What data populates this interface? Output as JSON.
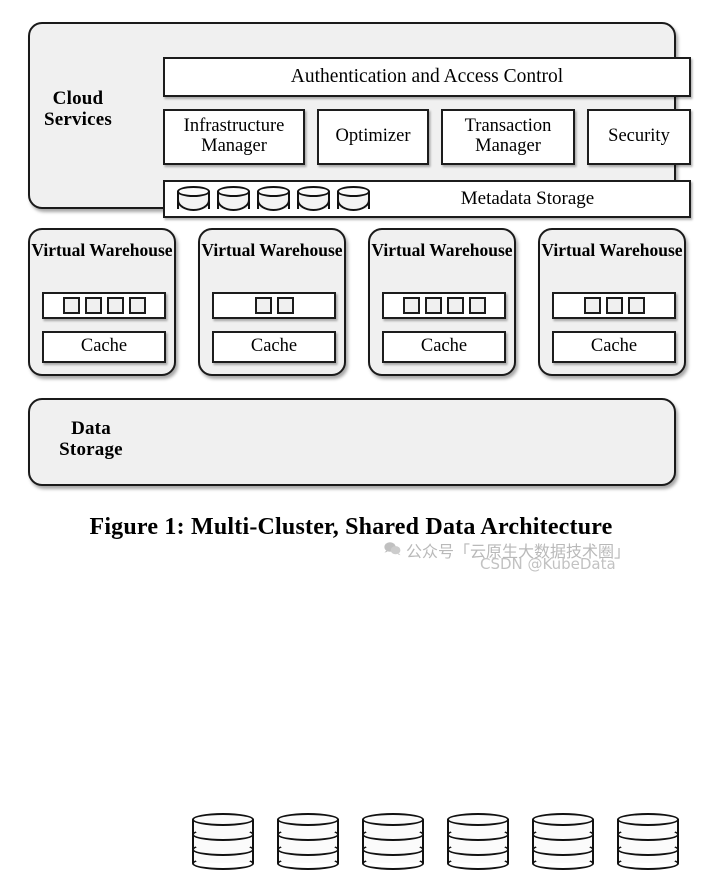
{
  "figure": {
    "caption": "Figure 1: Multi-Cluster, Shared Data Architecture"
  },
  "cloud_services": {
    "label": "Cloud Services",
    "auth_box": "Authentication and Access Control",
    "services": [
      {
        "label": "Infrastructure Manager"
      },
      {
        "label": "Optimizer"
      },
      {
        "label": "Transaction Manager"
      },
      {
        "label": "Security"
      }
    ],
    "metadata": {
      "label": "Metadata Storage",
      "cylinder_count": 5,
      "cylinder_icon": "database-cylinder-icon"
    }
  },
  "virtual_warehouses": [
    {
      "title": "Virtual Warehouse",
      "workers": 4,
      "cache_label": "Cache"
    },
    {
      "title": "Virtual Warehouse",
      "workers": 2,
      "cache_label": "Cache"
    },
    {
      "title": "Virtual Warehouse",
      "workers": 4,
      "cache_label": "Cache"
    },
    {
      "title": "Virtual Warehouse",
      "workers": 3,
      "cache_label": "Cache"
    }
  ],
  "data_storage": {
    "label": "Data Storage",
    "cylinder_count": 6,
    "cylinder_segments": 3,
    "cylinder_icon": "database-cylinder-icon"
  },
  "watermark": {
    "icon": "wechat-icon",
    "line1": "公众号「云原生大数据技术圈」",
    "line2": "CSDN @KubeData"
  },
  "colors": {
    "page_background": "#ffffff",
    "panel_fill": "#f0f0f0",
    "box_fill": "#ffffff",
    "stroke": "#1a1a1a",
    "watermark_text": "#bdbdbd"
  }
}
